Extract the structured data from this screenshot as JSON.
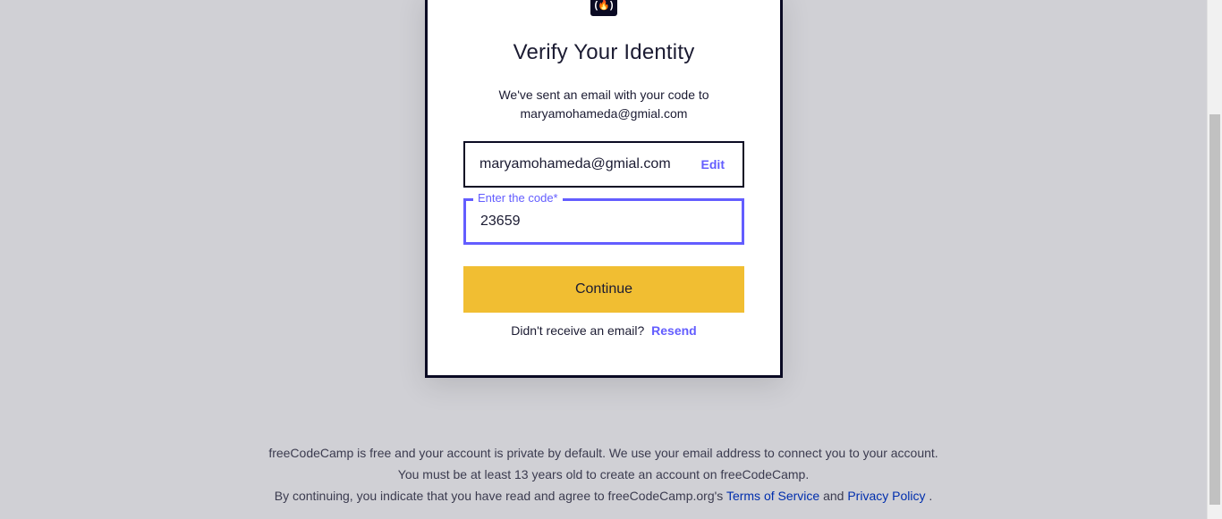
{
  "card": {
    "logo_text": "(🔥)",
    "title": "Verify Your Identity",
    "subtitle_line1": "We've sent an email with your code to",
    "subtitle_line2": "maryamohameda@gmial.com",
    "email_field": {
      "value": "maryamohameda@gmial.com",
      "edit_label": "Edit"
    },
    "code_field": {
      "label": "Enter the code*",
      "value": "23659"
    },
    "continue_label": "Continue",
    "resend_prompt": "Didn't receive an email?",
    "resend_label": "Resend"
  },
  "footer": {
    "line1": "freeCodeCamp is free and your account is private by default. We use your email address to connect you to your account.",
    "line2": "You must be at least 13 years old to create an account on freeCodeCamp.",
    "line3_prefix": "By continuing, you indicate that you have read and agree to freeCodeCamp.org's",
    "terms_label": "Terms of Service",
    "and_word": "and",
    "privacy_label": "Privacy Policy",
    "line3_suffix": "."
  },
  "colors": {
    "background": "#d0d0d5",
    "accent": "#635dff",
    "button": "#f1be32",
    "dark": "#0a0a23",
    "link": "#002ead"
  }
}
